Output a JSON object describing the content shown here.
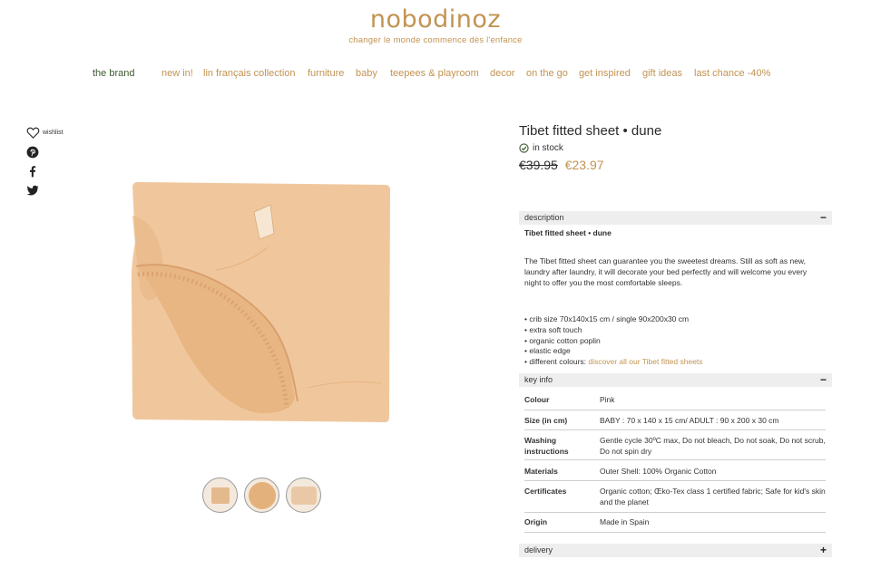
{
  "header": {
    "logo": "nobodinoz",
    "tagline": "changer le monde commence dès l'enfance"
  },
  "nav": {
    "items": [
      "the brand",
      "new in!",
      "lin français collection",
      "furniture",
      "baby",
      "teepees & playroom",
      "decor",
      "on the go",
      "get inspired",
      "gift ideas",
      "last chance -40%"
    ]
  },
  "share": {
    "wishlist": "wishlist",
    "icons": [
      "heart-icon",
      "pinterest-icon",
      "facebook-icon",
      "twitter-icon"
    ]
  },
  "product": {
    "title": "Tibet fitted sheet • dune",
    "stock": "in stock",
    "price_old": "€39.95",
    "price_new": "€23.97",
    "color_swatch": "#f0c79d"
  },
  "description": {
    "header": "description",
    "toggle": "−",
    "title": "Tibet fitted sheet • dune",
    "text": "The Tibet fitted sheet can guarantee you the sweetest dreams. Still as soft as new, laundry after laundry, it will decorate your bed perfectly and will welcome you every night to offer you the most comfortable sleeps.",
    "bullets": [
      "• crib size 70x140x15 cm / single 90x200x30 cm",
      "• extra soft touch",
      "• organic cotton poplin",
      "• elastic edge"
    ],
    "colours_prefix": "• different colours: ",
    "colours_link": "discover all our Tibet fitted sheets"
  },
  "key_info": {
    "header": "key info",
    "toggle": "−",
    "rows": [
      {
        "key": "Colour",
        "value": "Pink"
      },
      {
        "key": "Size (in cm)",
        "value": "BABY : 70 x 140 x 15 cm/ ADULT : 90 x 200 x 30 cm"
      },
      {
        "key": "Washing instructions",
        "value": "Gentle cycle 30ºC max, Do not bleach, Do not soak, Do not scrub, Do not spin dry"
      },
      {
        "key": "Materials",
        "value": "Outer Shell: 100% Organic Cotton"
      },
      {
        "key": "Certificates",
        "value": "Organic cotton; Œko-Tex class 1 certified fabric; Safe for kid's skin and the planet"
      },
      {
        "key": "Origin",
        "value": "Made in Spain"
      }
    ]
  },
  "delivery": {
    "header": "delivery",
    "toggle": "+"
  },
  "colors": {
    "accent": "#c29352",
    "brand_green": "#3c5a2e"
  }
}
